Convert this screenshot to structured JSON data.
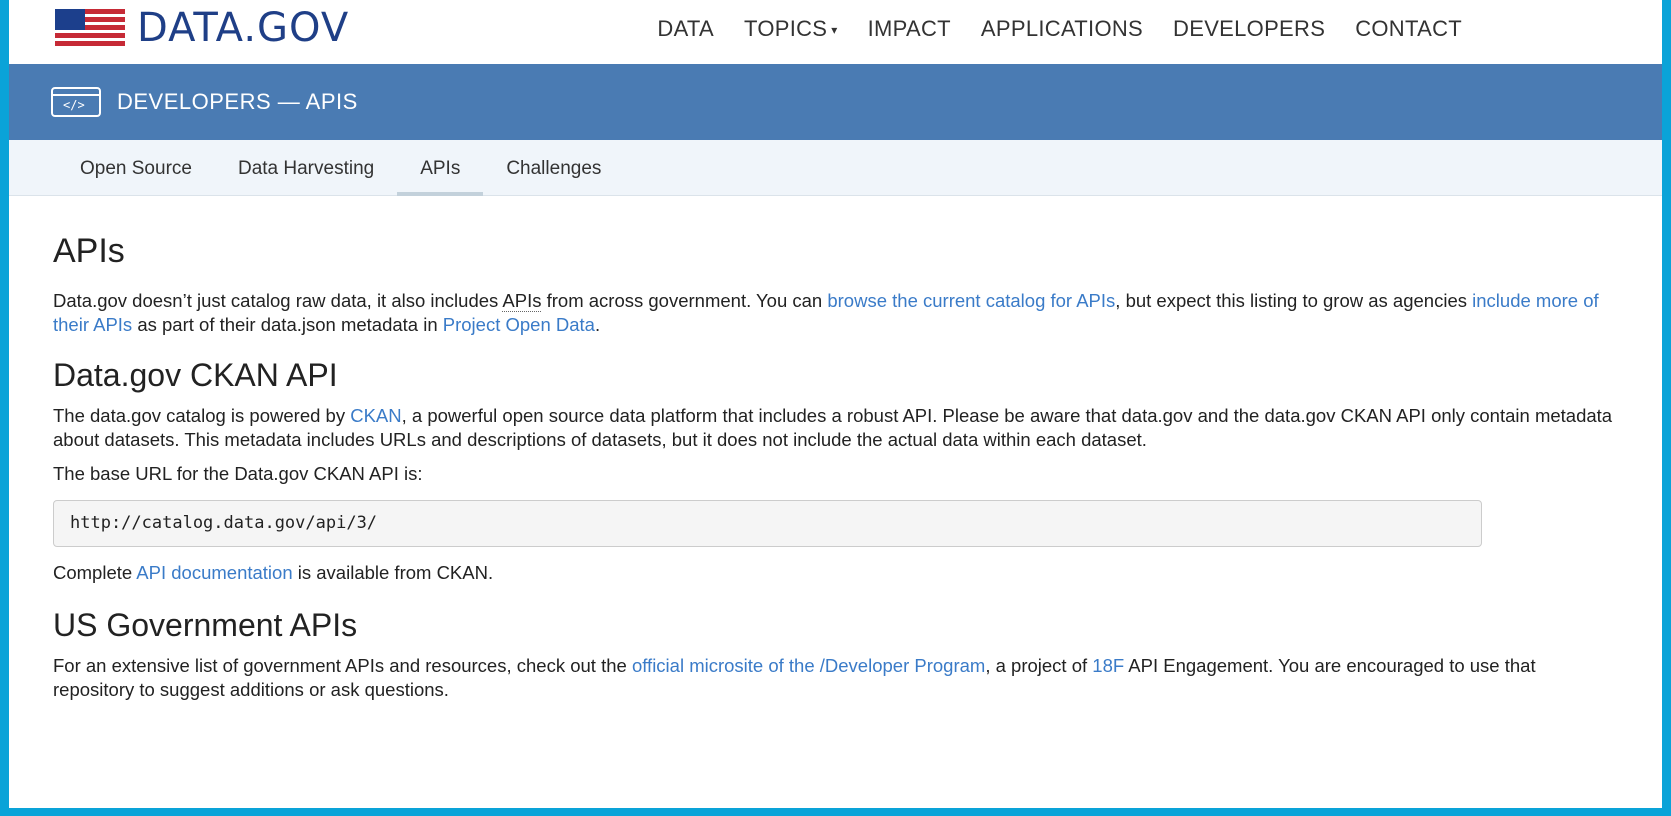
{
  "header": {
    "logo_text": "DATA.GOV",
    "nav": [
      {
        "label": "DATA"
      },
      {
        "label": "TOPICS",
        "has_caret": true
      },
      {
        "label": "IMPACT"
      },
      {
        "label": "APPLICATIONS"
      },
      {
        "label": "DEVELOPERS"
      },
      {
        "label": "CONTACT"
      }
    ],
    "caret_glyph": "▾"
  },
  "band": {
    "title": "DEVELOPERS — APIS",
    "icon_glyph": "</>"
  },
  "subnav": {
    "tabs": [
      {
        "label": "Open Source"
      },
      {
        "label": "Data Harvesting"
      },
      {
        "label": "APIs",
        "active": true
      },
      {
        "label": "Challenges"
      }
    ]
  },
  "main": {
    "apis": {
      "heading": "APIs",
      "p1_a": "Data.gov doesn’t just catalog raw data, it also includes ",
      "p1_abbr": "APIs",
      "p1_b": " from across government. You can ",
      "p1_link1": "browse the current catalog for APIs",
      "p1_c": ", but expect this listing to grow as agencies ",
      "p1_link2": "include more of their APIs",
      "p1_d": " as part of their data.json metadata in ",
      "p1_link3": "Project Open Data",
      "p1_e": "."
    },
    "ckan": {
      "heading": "Data.gov CKAN API",
      "p1_a": "The data.gov catalog is powered by ",
      "p1_link": "CKAN",
      "p1_b": ", a powerful open source data platform that includes a robust API. Please be aware that data.gov and the data.gov CKAN API only contain metadata about datasets. This metadata includes URLs and descriptions of datasets, but it does not include the actual data within each dataset.",
      "p2": "The base URL for the Data.gov CKAN API is:",
      "code": "http://catalog.data.gov/api/3/",
      "p3_a": "Complete ",
      "p3_link": "API documentation",
      "p3_b": " is available from CKAN."
    },
    "usgov": {
      "heading": "US Government APIs",
      "p1_a": "For an extensive list of government APIs and resources, check out the ",
      "p1_link1": "official microsite of the /Developer Program",
      "p1_b": ", a project of ",
      "p1_link2": "18F",
      "p1_c": " API Engagement. You are encouraged to use that repository to suggest additions or ask questions."
    }
  },
  "colors": {
    "border": "#0aa3d8",
    "band": "#4a7bb3",
    "link": "#3a7bc8",
    "logo": "#1f3f87",
    "flag_red": "#c62a36"
  }
}
